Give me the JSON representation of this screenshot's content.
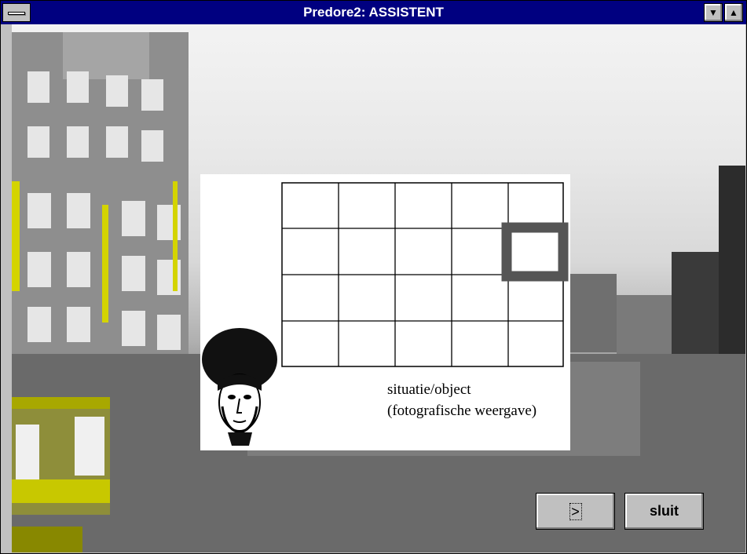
{
  "window": {
    "title": "Predore2: ASSISTENT",
    "minimize_glyph": "▼",
    "maximize_glyph": "▲"
  },
  "panel": {
    "caption_line1": "situatie/object",
    "caption_line2": "(fotografische weergave)",
    "grid": {
      "rows": 4,
      "cols": 5,
      "highlighted_cell": {
        "row": 2,
        "col": 5
      }
    }
  },
  "buttons": {
    "next_label": ">",
    "close_label": "sluit"
  }
}
